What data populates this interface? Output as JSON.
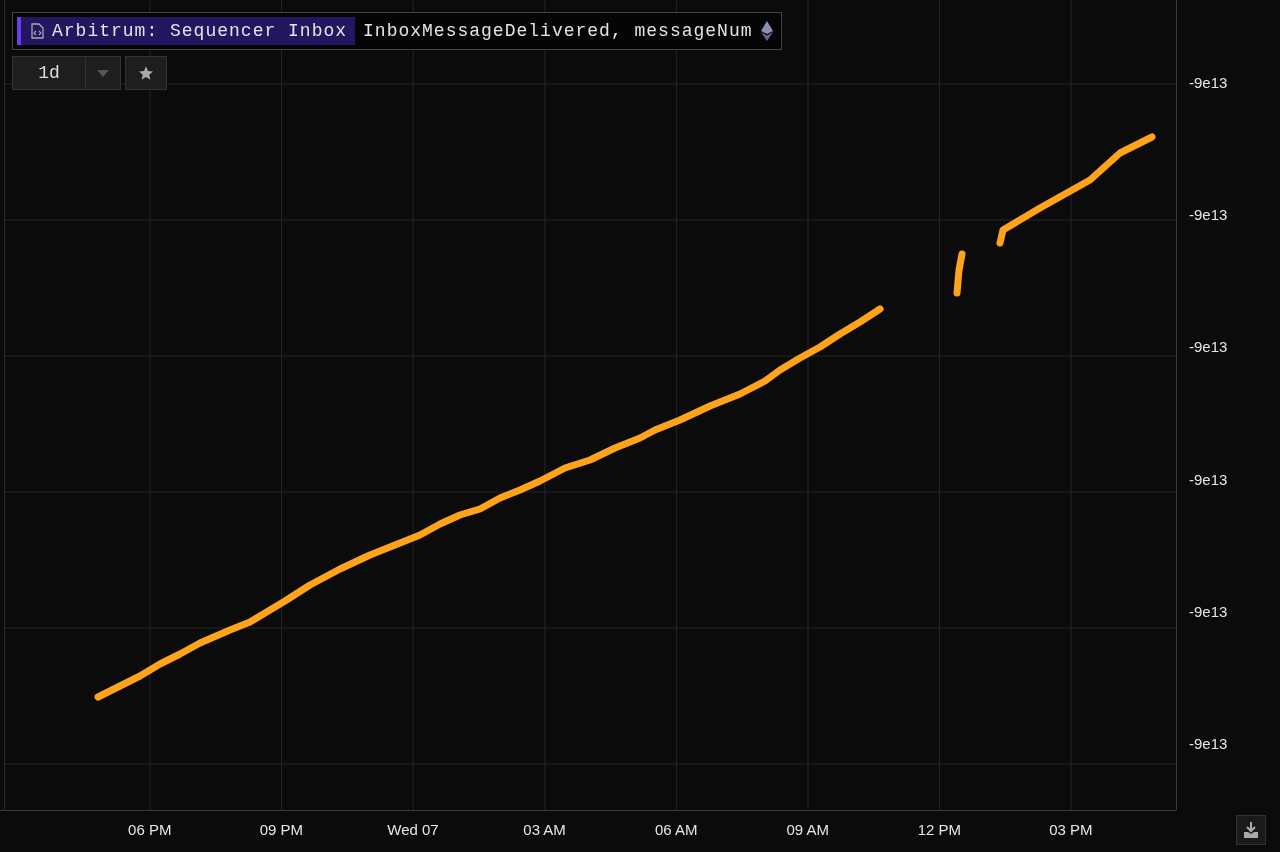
{
  "legend": {
    "contract": "Arbitrum: Sequencer Inbox",
    "event_field": "InboxMessageDelivered, messageNum"
  },
  "range_button": {
    "label": "1d"
  },
  "y_axis": {
    "ticks": [
      "-9e13",
      "-9e13",
      "-9e13",
      "-9e13",
      "-9e13",
      "-9e13"
    ]
  },
  "x_axis": {
    "ticks": [
      "06 PM",
      "09 PM",
      "Wed 07",
      "03 AM",
      "06 AM",
      "09 AM",
      "12 PM",
      "03 PM"
    ]
  }
}
